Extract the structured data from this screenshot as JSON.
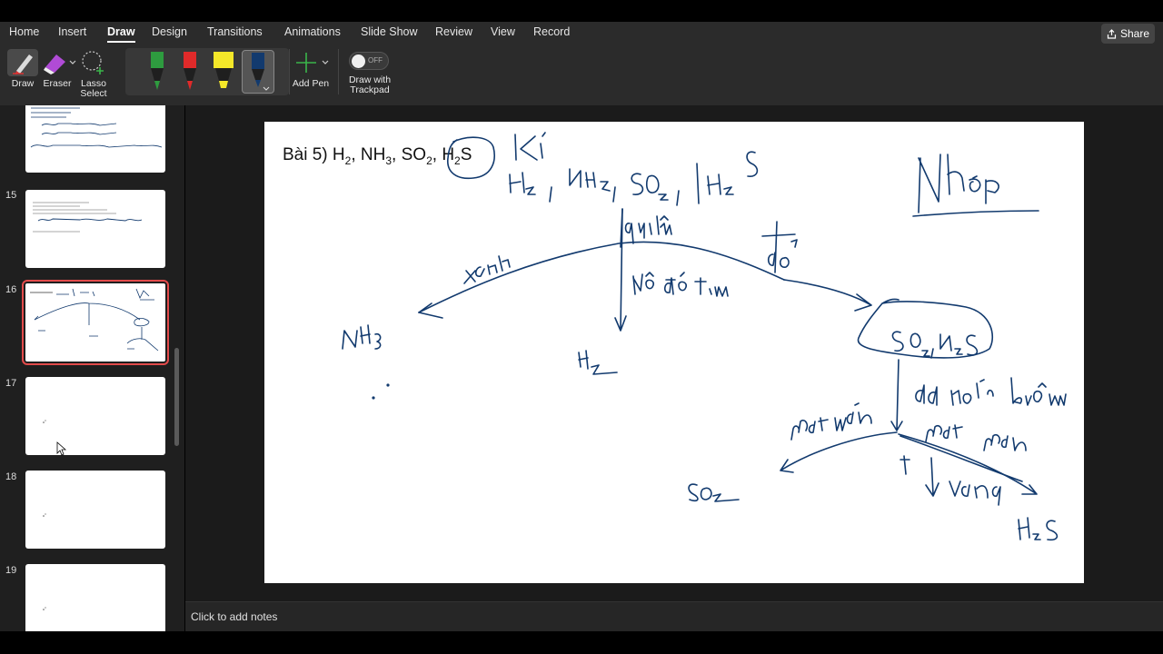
{
  "ribbon": {
    "tabs": [
      "Home",
      "Insert",
      "Draw",
      "Design",
      "Transitions",
      "Animations",
      "Slide Show",
      "Review",
      "View",
      "Record"
    ],
    "active_tab": "Draw",
    "share_label": "Share",
    "tools": {
      "draw_label": "Draw",
      "eraser_label": "Eraser",
      "lasso_label": "Lasso Select",
      "add_pen_label": "Add Pen",
      "trackpad_label": "Draw with Trackpad",
      "toggle_state": "OFF"
    },
    "pens": [
      {
        "name": "green-pen",
        "color": "#2e9b3f"
      },
      {
        "name": "red-pen",
        "color": "#e02a2a"
      },
      {
        "name": "yellow-highlighter",
        "color": "#f5e829"
      },
      {
        "name": "navy-pen",
        "color": "#123a6e"
      }
    ]
  },
  "slides_panel": {
    "numbers": [
      "15",
      "16",
      "17",
      "18",
      "19"
    ],
    "selected": "16"
  },
  "slide": {
    "title": {
      "prefix": "Bài 5) ",
      "items": [
        {
          "text": "H",
          "sub": "2",
          "tail": ", "
        },
        {
          "text": "NH",
          "sub": "3",
          "tail": ", "
        },
        {
          "text": "SO",
          "sub": "2",
          "tail": ", "
        },
        {
          "text": "H",
          "sub": "2",
          "tail": "S"
        }
      ]
    },
    "ink_color": "#123a6e"
  },
  "notes": {
    "placeholder": "Click to add notes"
  },
  "colors": {
    "ribbon_bg": "#2b2b2b",
    "panel_bg": "#1f1f1f",
    "selection_outline": "#e34b4b"
  }
}
